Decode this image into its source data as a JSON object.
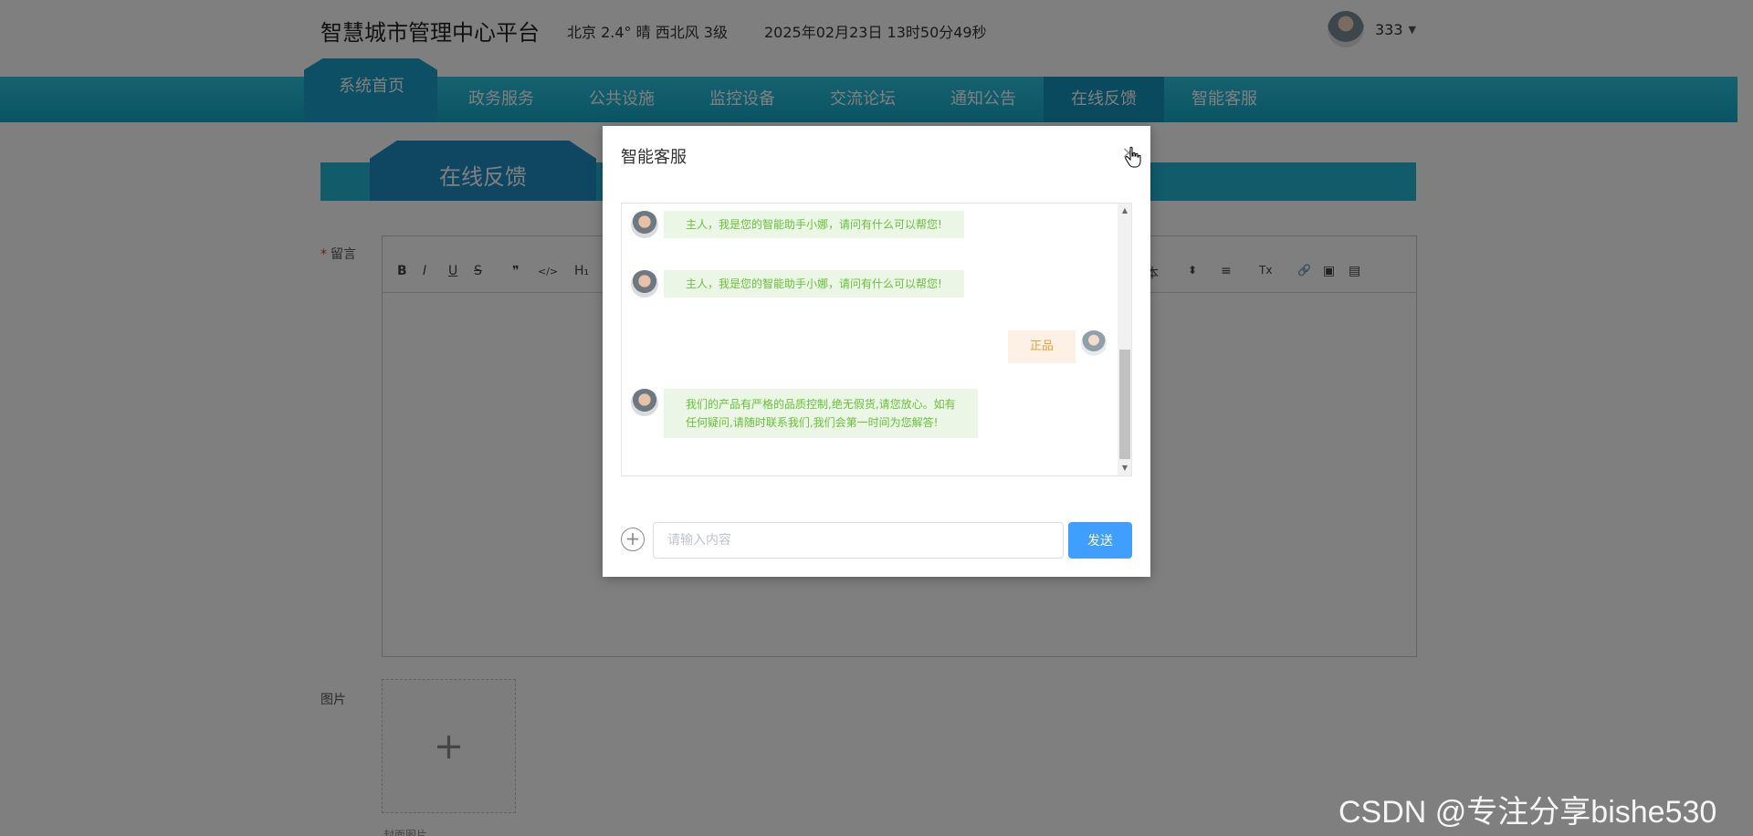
{
  "header": {
    "site_title": "智慧城市管理中心平台",
    "weather": "北京  2.4°  晴  西北风  3级",
    "datetime": "2025年02月23日 13时50分49秒",
    "user_name": "333"
  },
  "nav": {
    "items": [
      "系统首页",
      "政务服务",
      "公共设施",
      "监控设备",
      "交流论坛",
      "通知公告",
      "在线反馈",
      "智能客服"
    ]
  },
  "page": {
    "banner_title": "在线反馈",
    "message_label": "留言",
    "required_mark": "*",
    "toolbar": {
      "bold": "B",
      "italic": "I",
      "underline": "U",
      "strike": "S",
      "quote": "❞",
      "code": "</>",
      "h1": "H₁",
      "font_fragment": "本",
      "stepper": "⬍",
      "align": "≡",
      "clear": "Tx",
      "link": "🔗",
      "image": "▣",
      "video": "▤"
    },
    "image_label": "图片",
    "upload_plus": "+",
    "truncated_label": "封面图片"
  },
  "dialog": {
    "title": "智能客服",
    "close_glyph": "×",
    "messages": [
      {
        "role": "bot",
        "text": "主人，我是您的智能助手小娜，请问有什么可以帮您!"
      },
      {
        "role": "bot",
        "text": "主人，我是您的智能助手小娜，请问有什么可以帮您!"
      },
      {
        "role": "user",
        "text": "正品"
      },
      {
        "role": "bot",
        "line1": "我们的产品有严格的品质控制,绝无假货,请您放心。如有",
        "line2": "任何疑问,请随时联系我们,我们会第一时间为您解答!"
      }
    ],
    "scroll_up": "▲",
    "scroll_down": "▼",
    "plus_glyph": "+",
    "input_placeholder": "请输入内容",
    "send_label": "发送"
  },
  "watermark": "CSDN @专注分享bishe530"
}
